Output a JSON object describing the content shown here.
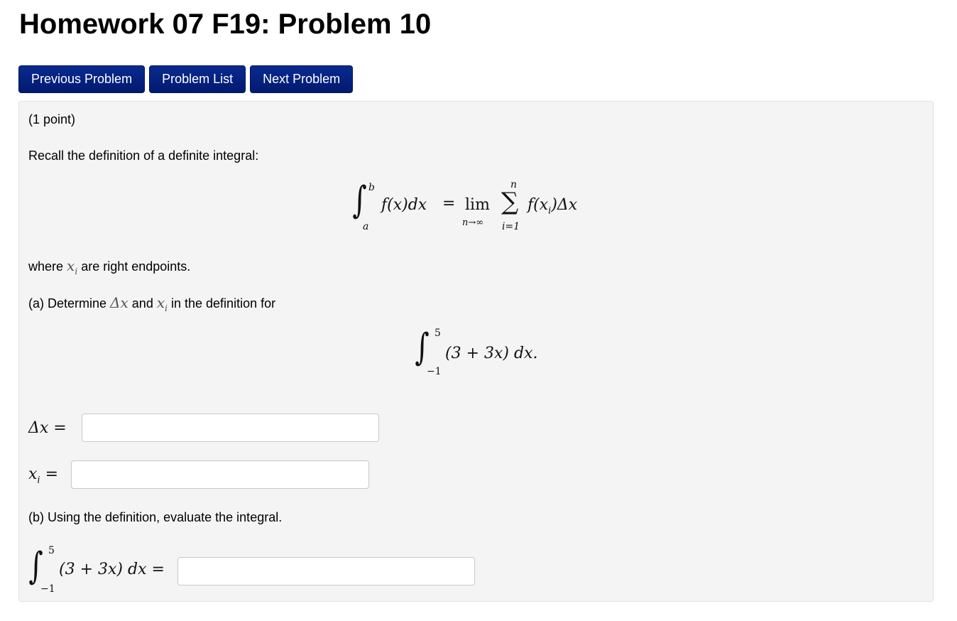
{
  "page": {
    "title": "Homework 07 F19: Problem 10"
  },
  "nav": {
    "previous_label": "Previous Problem",
    "list_label": "Problem List",
    "next_label": "Next Problem"
  },
  "problem": {
    "points": "(1 point)",
    "intro": "Recall the definition of a definite integral:",
    "definition": {
      "lower": "a",
      "upper": "b",
      "integrand": "f(x)dx",
      "equals": "=",
      "lim": "lim",
      "lim_sub": "n→∞",
      "sum_upper": "n",
      "sum_lower": "i=1",
      "sum_symbol": "∑",
      "sum_term": "f(x",
      "sum_term_sub": "i",
      "sum_term_end": ")Δx"
    },
    "where_prefix": "where",
    "where_var": "x",
    "where_sub": "i",
    "where_suffix": "are right endpoints.",
    "part_a": {
      "prefix": "(a) Determine",
      "dx": "Δx",
      "and": "and",
      "xi": "x",
      "xi_sub": "i",
      "suffix": "in the definition for"
    },
    "integral": {
      "lower": "−1",
      "upper": "5",
      "body": "(3 + 3x) dx."
    },
    "answers": {
      "delta_x_label": "Δx =",
      "delta_x_value": "",
      "xi_label": "x",
      "xi_sub": "i",
      "xi_eq": "=",
      "xi_value": ""
    },
    "part_b": {
      "text": "(b) Using the definition, evaluate the integral.",
      "lower": "−1",
      "upper": "5",
      "body": "(3 + 3x) dx =",
      "value": ""
    }
  },
  "colors": {
    "button_bg": "#001a70",
    "panel_bg": "#f4f4f4"
  }
}
